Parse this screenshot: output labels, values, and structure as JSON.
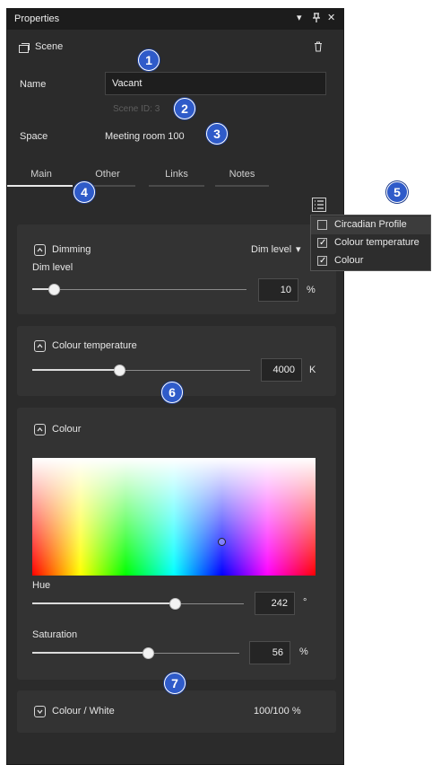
{
  "panel": {
    "title": "Properties",
    "controls": {
      "dropdown": "▾",
      "pin": "⊥",
      "close": "✕"
    }
  },
  "scene": {
    "icon": "scene-icon",
    "label": "Scene",
    "delete_icon": "trash-icon"
  },
  "fields": {
    "name_label": "Name",
    "name_value": "Vacant",
    "scene_id": "Scene ID: 3",
    "space_label": "Space",
    "space_value": "Meeting room 100"
  },
  "tabs": [
    {
      "label": "Main",
      "active": true
    },
    {
      "label": "Other",
      "active": false
    },
    {
      "label": "Links",
      "active": false
    },
    {
      "label": "Notes",
      "active": false
    }
  ],
  "dimming": {
    "title": "Dimming",
    "mode": "Dim level",
    "slider_label": "Dim level",
    "value": "10",
    "unit": "%",
    "level": 0.1
  },
  "colour_temperature": {
    "title": "Colour temperature",
    "value": "4000",
    "unit": "K",
    "level": 0.4
  },
  "colour": {
    "title": "Colour",
    "hue_label": "Hue",
    "hue_value": "242",
    "hue_unit": "°",
    "hue_level": 0.672,
    "saturation_label": "Saturation",
    "saturation_value": "56",
    "saturation_unit": "%",
    "saturation_level": 0.56
  },
  "colour_white": {
    "title": "Colour / White",
    "value": "100/100 %"
  },
  "popup": {
    "items": [
      {
        "label": "Circadian Profile",
        "checked": false
      },
      {
        "label": "Colour temperature",
        "checked": true
      },
      {
        "label": "Colour",
        "checked": true
      }
    ]
  },
  "badges": [
    "1",
    "2",
    "3",
    "4",
    "5",
    "6",
    "7"
  ],
  "colors": {
    "panel_bg": "#2b2b2b",
    "section_bg": "#333333",
    "badge": "#2f5bc9",
    "titlebar": "#1c1c1c"
  }
}
